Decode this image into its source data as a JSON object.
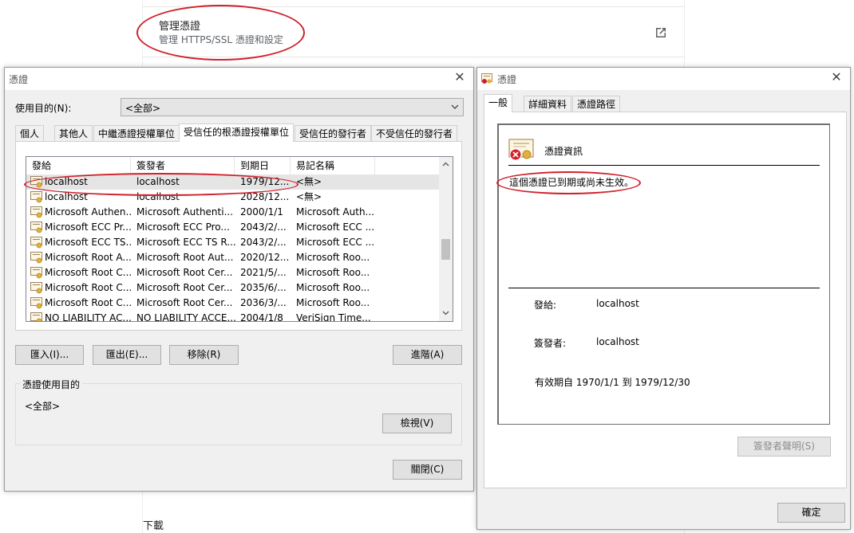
{
  "settings": {
    "manage_title": "管理憑證",
    "manage_subtitle": "管理 HTTPS/SSL 憑證和設定",
    "download_label": "下載"
  },
  "cert_manager": {
    "title": "憑證",
    "purpose_label": "使用目的(N):",
    "purpose_value": "<全部>",
    "tabs": [
      "個人",
      "其他人",
      "中繼憑證授權單位",
      "受信任的根憑證授權單位",
      "受信任的發行者",
      "不受信任的發行者"
    ],
    "columns": [
      "發給",
      "簽發者",
      "到期日",
      "易記名稱"
    ],
    "rows": [
      [
        "localhost",
        "localhost",
        "1979/12...",
        "<無>"
      ],
      [
        "localhost",
        "localhost",
        "2028/12...",
        "<無>"
      ],
      [
        "Microsoft Authen...",
        "Microsoft Authenti...",
        "2000/1/1",
        "Microsoft Auth..."
      ],
      [
        "Microsoft ECC Pr...",
        "Microsoft ECC Pro...",
        "2043/2/...",
        "Microsoft ECC ..."
      ],
      [
        "Microsoft ECC TS...",
        "Microsoft ECC TS R...",
        "2043/2/...",
        "Microsoft ECC ..."
      ],
      [
        "Microsoft Root A...",
        "Microsoft Root Aut...",
        "2020/12...",
        "Microsoft Roo..."
      ],
      [
        "Microsoft Root C...",
        "Microsoft Root Cer...",
        "2021/5/...",
        "Microsoft Roo..."
      ],
      [
        "Microsoft Root C...",
        "Microsoft Root Cer...",
        "2035/6/...",
        "Microsoft Roo..."
      ],
      [
        "Microsoft Root C...",
        "Microsoft Root Cer...",
        "2036/3/...",
        "Microsoft Roo..."
      ],
      [
        "NO LIABILITY AC...",
        "NO LIABILITY ACCE...",
        "2004/1/8",
        "VeriSign Time..."
      ]
    ],
    "buttons": {
      "import": "匯入(I)...",
      "export": "匯出(E)...",
      "remove": "移除(R)",
      "advanced": "進階(A)",
      "view": "檢視(V)",
      "close": "關閉(C)"
    },
    "purposes_group_label": "憑證使用目的",
    "purposes_value": "<全部>"
  },
  "cert_detail": {
    "title": "憑證",
    "tabs": [
      "一般",
      "詳細資料",
      "憑證路徑"
    ],
    "info_heading": "憑證資訊",
    "error_text": "這個憑證已到期或尚未生效。",
    "issued_to_label": "發給:",
    "issued_to_value": "localhost",
    "issued_by_label": "簽發者:",
    "issued_by_value": "localhost",
    "validity_label": "有效期自",
    "valid_from": "1970/1/1",
    "validity_to": "到",
    "valid_to": "1979/12/30",
    "issuer_statement_button": "簽發者聲明(S)",
    "ok_button": "確定"
  },
  "colors": {
    "annotation_red": "#d0212b",
    "selected_row": "#e5e5e5"
  }
}
